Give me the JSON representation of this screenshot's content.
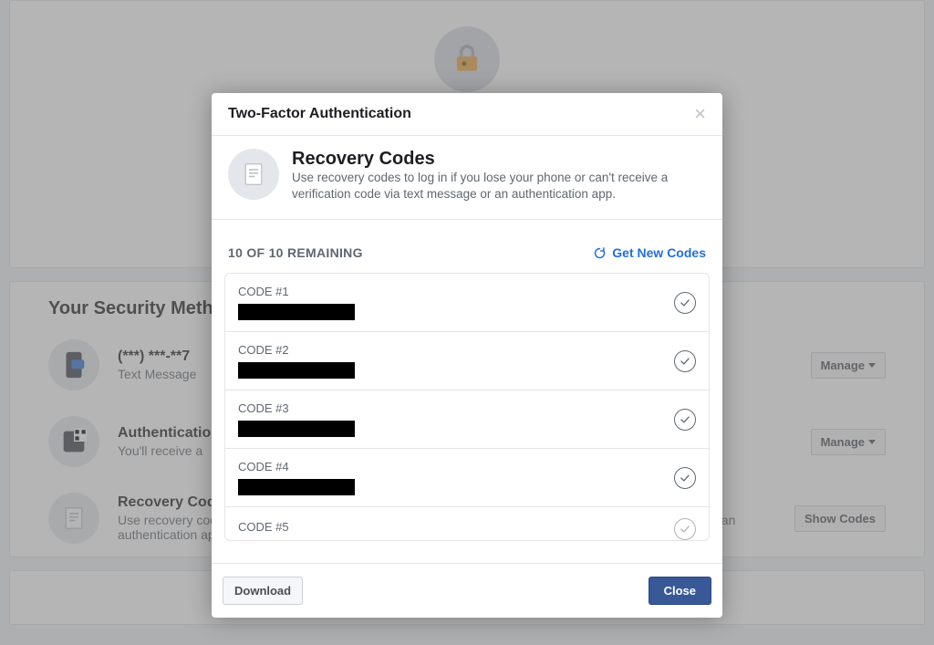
{
  "background": {
    "sectionHeader": "Your Security Methods",
    "methods": [
      {
        "title": "(***) ***-**7",
        "sub": "Text Message",
        "btn": "Manage",
        "hasCaret": true
      },
      {
        "title": "Authentication",
        "sub": "You'll receive a",
        "btn": "Manage",
        "hasCaret": true
      },
      {
        "title": "Recovery Codes",
        "sub": "Use recovery codes to log in if you lose your phone or can't receive a verification code via text message or an authentication app.",
        "btn": "Show Codes",
        "hasCaret": false
      }
    ]
  },
  "modal": {
    "title": "Two-Factor Authentication",
    "infoTitle": "Recovery Codes",
    "infoDesc": "Use recovery codes to log in if you lose your phone or can't receive a verification code via text message or an authentication app.",
    "remaining": "10 OF 10 REMAINING",
    "getNew": "Get New Codes",
    "codes": [
      {
        "label": "CODE #1"
      },
      {
        "label": "CODE #2"
      },
      {
        "label": "CODE #3"
      },
      {
        "label": "CODE #4"
      },
      {
        "label": "CODE #5"
      }
    ],
    "download": "Download",
    "close": "Close"
  }
}
